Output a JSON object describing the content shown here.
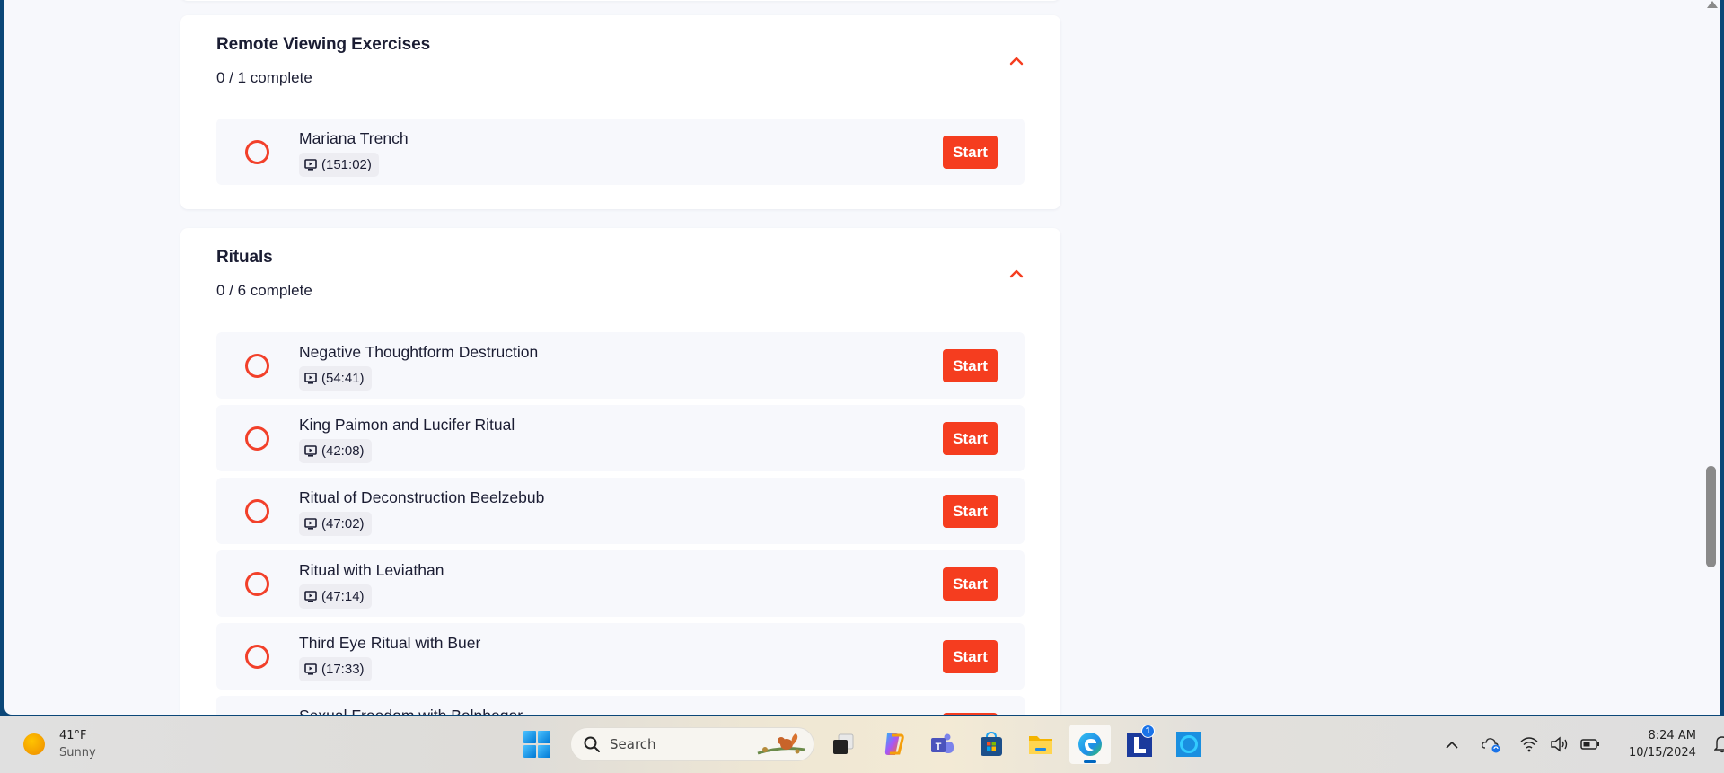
{
  "sections": [
    {
      "title": "Remote Viewing Exercises",
      "progress": "0 / 1 complete",
      "expanded": true,
      "lessons": [
        {
          "title": "Mariana Trench",
          "duration": "(151:02)",
          "completed": false,
          "action": "Start"
        }
      ]
    },
    {
      "title": "Rituals",
      "progress": "0 / 6 complete",
      "expanded": true,
      "lessons": [
        {
          "title": "Negative Thoughtform Destruction",
          "duration": "(54:41)",
          "completed": false,
          "action": "Start"
        },
        {
          "title": "King Paimon and Lucifer Ritual",
          "duration": "(42:08)",
          "completed": false,
          "action": "Start"
        },
        {
          "title": "Ritual of Deconstruction Beelzebub",
          "duration": "(47:02)",
          "completed": false,
          "action": "Start"
        },
        {
          "title": "Ritual with Leviathan",
          "duration": "(47:14)",
          "completed": false,
          "action": "Start"
        },
        {
          "title": "Third Eye Ritual with Buer",
          "duration": "(17:33)",
          "completed": false,
          "action": "Start"
        },
        {
          "title": "Sexual Freedom with Belphegor",
          "duration": "",
          "completed": false,
          "action": "Start"
        }
      ]
    }
  ],
  "colors": {
    "accent": "#f53d1f",
    "title_text": "#1b1d33",
    "page_bg": "#f7f8fc",
    "window_border": "#0b4778"
  },
  "taskbar": {
    "weather": {
      "temp": "41°F",
      "condition": "Sunny",
      "icon": "sun-icon"
    },
    "search_placeholder": "Search",
    "apps": [
      {
        "name": "task-view",
        "icon": "task-view-icon"
      },
      {
        "name": "copilot",
        "icon": "copilot-icon"
      },
      {
        "name": "teams",
        "icon": "teams-icon"
      },
      {
        "name": "microsoft-store",
        "icon": "store-icon"
      },
      {
        "name": "file-explorer",
        "icon": "folder-icon"
      },
      {
        "name": "edge",
        "icon": "edge-icon",
        "active": true
      },
      {
        "name": "l-app",
        "icon": "l-app-icon",
        "badge": "1"
      },
      {
        "name": "alexa",
        "icon": "alexa-icon"
      }
    ],
    "tray": [
      "chevron-up-icon",
      "onedrive-sync-icon",
      "wifi-icon",
      "volume-icon",
      "battery-icon"
    ],
    "time": "8:24 AM",
    "date": "10/15/2024"
  }
}
